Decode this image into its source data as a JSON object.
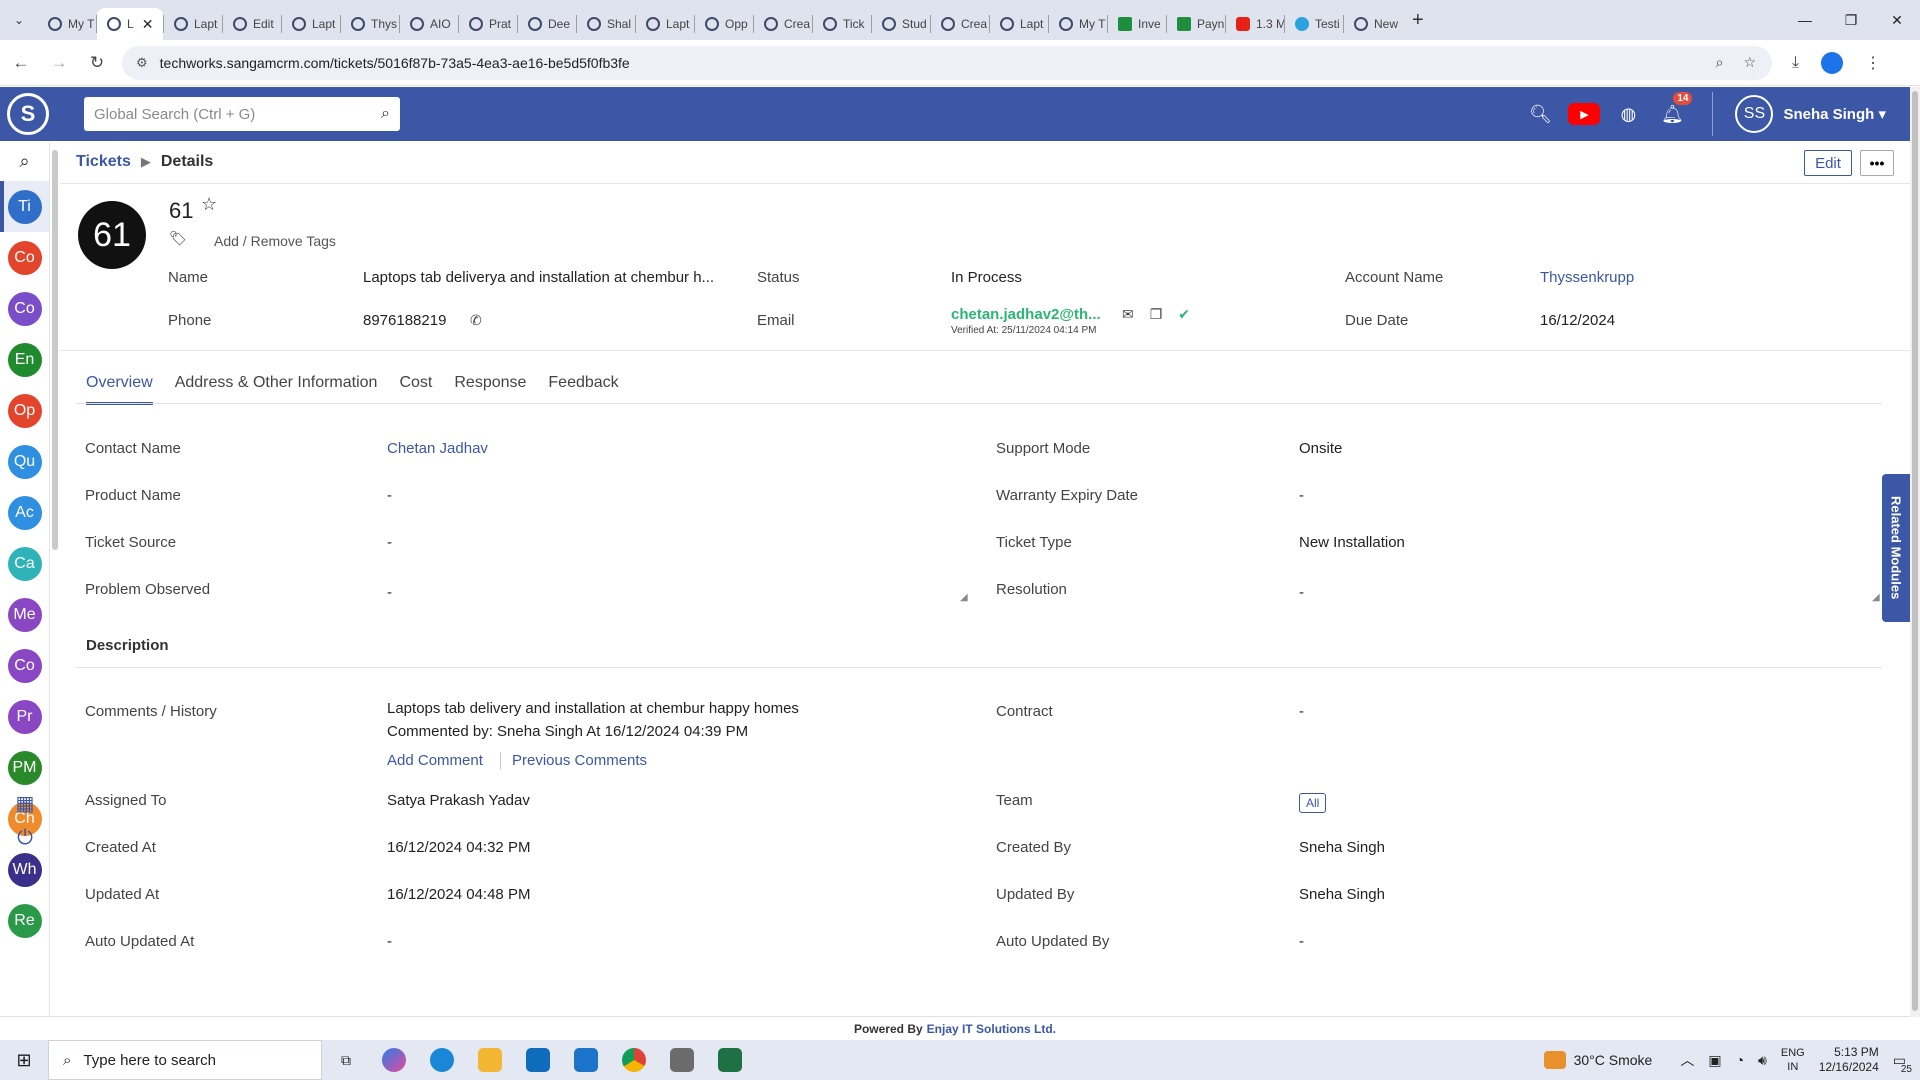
{
  "browser": {
    "tabs": [
      {
        "label": "My T",
        "fav": "crm"
      },
      {
        "label": "L",
        "fav": "crm",
        "active": true
      },
      {
        "label": "Lapt",
        "fav": "crm"
      },
      {
        "label": "Edit",
        "fav": "crm"
      },
      {
        "label": "Lapt",
        "fav": "crm"
      },
      {
        "label": "Thys",
        "fav": "crm"
      },
      {
        "label": "AIO",
        "fav": "crm"
      },
      {
        "label": "Prat",
        "fav": "crm"
      },
      {
        "label": "Dee",
        "fav": "crm"
      },
      {
        "label": "Shal",
        "fav": "crm"
      },
      {
        "label": "Lapt",
        "fav": "crm"
      },
      {
        "label": "Opp",
        "fav": "crm"
      },
      {
        "label": "Crea",
        "fav": "crm"
      },
      {
        "label": "Tick",
        "fav": "crm"
      },
      {
        "label": "Stud",
        "fav": "crm"
      },
      {
        "label": "Crea",
        "fav": "crm"
      },
      {
        "label": "Lapt",
        "fav": "crm"
      },
      {
        "label": "My T",
        "fav": "crm"
      },
      {
        "label": "Inve",
        "fav": "sheets"
      },
      {
        "label": "Payn",
        "fav": "sheets"
      },
      {
        "label": "1.3 M",
        "fav": "youtube"
      },
      {
        "label": "Testi",
        "fav": "telegram"
      },
      {
        "label": "New",
        "fav": "crm"
      }
    ],
    "url": "techworks.sangamcrm.com/tickets/5016f87b-73a5-4ea3-ae16-be5d5f0fb3fe"
  },
  "header": {
    "search_placeholder": "Global Search (Ctrl + G)",
    "notification_count": "14",
    "user_initials": "SS",
    "user_name": "Sneha Singh"
  },
  "rail": {
    "items": [
      {
        "label": "Ti",
        "color": "#2f6fca",
        "active": true
      },
      {
        "label": "Co",
        "color": "#e2452b"
      },
      {
        "label": "Co",
        "color": "#7b4ec9"
      },
      {
        "label": "En",
        "color": "#1f8a2e"
      },
      {
        "label": "Op",
        "color": "#e2452b"
      },
      {
        "label": "Qu",
        "color": "#2f8fe0"
      },
      {
        "label": "Ac",
        "color": "#2f8fe0"
      },
      {
        "label": "Ca",
        "color": "#2fb3b8"
      },
      {
        "label": "Me",
        "color": "#8a47c4"
      },
      {
        "label": "Co",
        "color": "#8a47c4"
      },
      {
        "label": "Pr",
        "color": "#8a47c4"
      },
      {
        "label": "PM",
        "color": "#2a8a2a"
      },
      {
        "label": "Ch",
        "color": "#f08a2a"
      },
      {
        "label": "Wh",
        "color": "#3b2f8a"
      },
      {
        "label": "Re",
        "color": "#2a9a48"
      }
    ]
  },
  "breadcrumb": {
    "root": "Tickets",
    "current": "Details"
  },
  "actions": {
    "edit": "Edit",
    "more": "•••"
  },
  "record": {
    "avatar_text": "61",
    "number": "61",
    "tags_link": "Add / Remove Tags",
    "fields": {
      "name_label": "Name",
      "name_value": "Laptops tab deliverya and installation at chembur h...",
      "status_label": "Status",
      "status_value": "In Process",
      "account_label": "Account Name",
      "account_value": "Thyssenkrupp",
      "phone_label": "Phone",
      "phone_value": "8976188219",
      "email_label": "Email",
      "email_value": "chetan.jadhav2@th...",
      "email_verified": "Verified At: 25/11/2024 04:14 PM",
      "due_label": "Due Date",
      "due_value": "16/12/2024"
    }
  },
  "tabs": [
    "Overview",
    "Address & Other Information",
    "Cost",
    "Response",
    "Feedback"
  ],
  "overview": {
    "contact_name_label": "Contact Name",
    "contact_name_value": "Chetan Jadhav",
    "support_mode_label": "Support Mode",
    "support_mode_value": "Onsite",
    "product_name_label": "Product Name",
    "product_name_value": "-",
    "warranty_label": "Warranty Expiry Date",
    "warranty_value": "-",
    "ticket_source_label": "Ticket Source",
    "ticket_source_value": "-",
    "ticket_type_label": "Ticket Type",
    "ticket_type_value": "New Installation",
    "problem_label": "Problem Observed",
    "problem_value": "-",
    "resolution_label": "Resolution",
    "resolution_value": "-",
    "description_title": "Description",
    "comments_label": "Comments / History",
    "comment_text": "Laptops tab delivery and installation at chembur happy homes",
    "comment_by": "Commented by: Sneha Singh At 16/12/2024 04:39 PM",
    "add_comment": "Add Comment",
    "previous_comments": "Previous Comments",
    "contract_label": "Contract",
    "contract_value": "-",
    "assigned_label": "Assigned To",
    "assigned_value": "Satya Prakash Yadav",
    "team_label": "Team",
    "team_value": "All",
    "created_at_label": "Created At",
    "created_at_value": "16/12/2024 04:32 PM",
    "created_by_label": "Created By",
    "created_by_value": "Sneha Singh",
    "updated_at_label": "Updated At",
    "updated_at_value": "16/12/2024 04:48 PM",
    "updated_by_label": "Updated By",
    "updated_by_value": "Sneha Singh",
    "auto_updated_at_label": "Auto Updated At",
    "auto_updated_at_value": "-",
    "auto_updated_by_label": "Auto Updated By",
    "auto_updated_by_value": "-"
  },
  "related_modules": "Related Modules",
  "footer": {
    "prefix": "Powered By",
    "brand": "Enjay IT Solutions Ltd."
  },
  "taskbar": {
    "search_placeholder": "Type here to search",
    "weather": "30°C  Smoke",
    "lang_top": "ENG",
    "lang_bottom": "IN",
    "time": "5:13 PM",
    "date": "12/16/2024",
    "notifications": "25"
  },
  "colors": {
    "brand": "#3b57a5",
    "verified_green": "#2cb673"
  }
}
